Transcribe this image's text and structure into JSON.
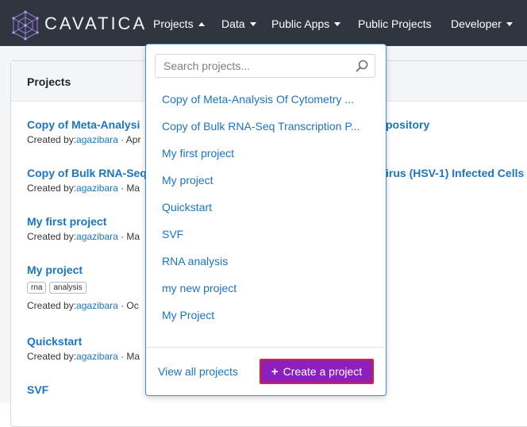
{
  "nav": {
    "brand": "CAVATICA",
    "items": [
      {
        "label": "Projects",
        "caret": "up"
      },
      {
        "label": "Data",
        "caret": "down"
      },
      {
        "label": "Public Apps",
        "caret": "down"
      },
      {
        "label": "Public Projects",
        "caret": ""
      },
      {
        "label": "Developer",
        "caret": "down"
      }
    ]
  },
  "panel": {
    "title": "Projects",
    "projects": [
      {
        "title": "Copy of Meta-Analysi",
        "created_label": "Created by:",
        "user": "agazibara",
        "date_fragment": " · Apr"
      },
      {
        "title": "Copy of Bulk RNA-Seq",
        "created_label": "Created by:",
        "user": "agazibara",
        "date_fragment": " · Ma"
      },
      {
        "title": "My first project",
        "created_label": "Created by:",
        "user": "agazibara",
        "date_fragment": " · Ma"
      },
      {
        "title": "My project",
        "created_label": "Created by:",
        "user": "agazibara",
        "date_fragment": " · Oc",
        "tags": [
          "rna",
          "analysis"
        ]
      },
      {
        "title": "Quickstart",
        "created_label": "Created by:",
        "user": "agazibara",
        "date_fragment": " · Ma"
      },
      {
        "title": "SVF"
      }
    ],
    "right_fragments": [
      "pository",
      "irus (HSV-1) Infected Cells"
    ]
  },
  "dropdown": {
    "search_placeholder": "Search projects...",
    "items": [
      "Copy of Meta-Analysis Of Cytometry ...",
      "Copy of Bulk RNA-Seq Transcription P...",
      "My first project",
      "My project",
      "Quickstart",
      "SVF",
      "RNA analysis",
      "my new project",
      "My Project"
    ],
    "view_all": "View all projects",
    "create_label": "Create a project"
  },
  "colors": {
    "topbar": "#2f3640",
    "link": "#1b74c5",
    "create_button": "#8e1fbf",
    "highlight_border": "#e0231b"
  }
}
